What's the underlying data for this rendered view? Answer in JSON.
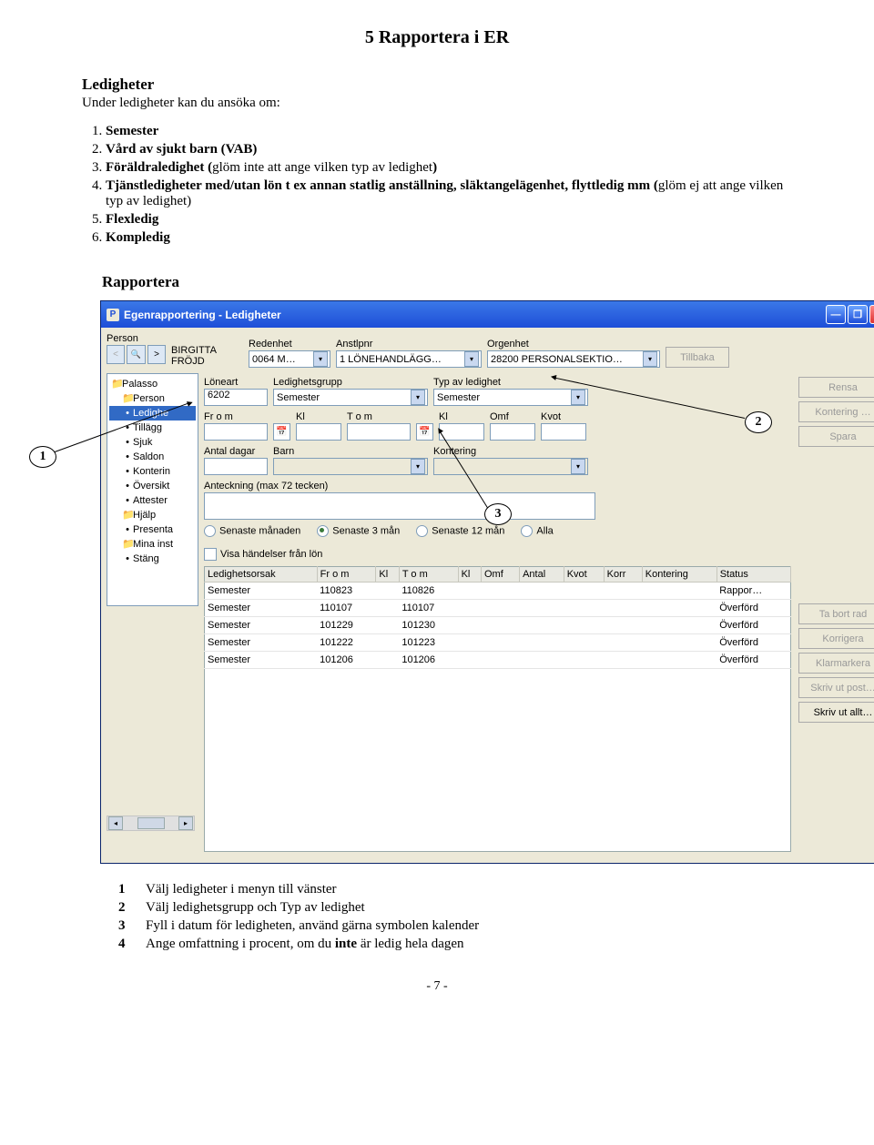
{
  "doc_title": "5 Rapportera i ER",
  "section": {
    "title": "Ledigheter",
    "sub": "Under ledigheter kan du ansöka om:"
  },
  "numlist": [
    {
      "bold": "Semester",
      "rest": ""
    },
    {
      "bold": "Vård av sjukt barn (VAB)",
      "rest": ""
    },
    {
      "bold": "Föräldraledighet (",
      "rest_plain": "glöm inte att ange vilken typ av ledighet",
      "bold_close": ")"
    },
    {
      "bold": "Tjänstledigheter med/utan lön t ex annan statlig anställning, släktangelägenhet, flyttledig mm (",
      "rest_plain": "glöm ej att ange vilken typ av ledighet)"
    },
    {
      "bold": "Flexledig",
      "rest": ""
    },
    {
      "bold": "Kompledig",
      "rest": ""
    }
  ],
  "rap_heading": "Rapportera",
  "window": {
    "title": "Egenrapportering - Ledigheter",
    "header": {
      "person_lbl": "Person",
      "person_val": "BIRGITTA FRÖJD",
      "redenhet_lbl": "Redenhet",
      "redenhet_val": "0064  M…",
      "anstlpnr_lbl": "Anstlpnr",
      "anstlpnr_val": "1   LÖNEHANDLÄGG…",
      "orgenhet_lbl": "Orgenhet",
      "orgenhet_val": "28200  PERSONALSEKTIO…",
      "tillbaka": "Tillbaka"
    },
    "tree": [
      {
        "icon": "📁",
        "text": "Palasso"
      },
      {
        "icon": "📁",
        "text": "Person",
        "indent": true
      },
      {
        "icon": "•",
        "text": "Ledighe",
        "indent": true,
        "sel": true
      },
      {
        "icon": "•",
        "text": "Tillägg",
        "indent": true
      },
      {
        "icon": "•",
        "text": "Sjuk",
        "indent": true
      },
      {
        "icon": "•",
        "text": "Saldon",
        "indent": true
      },
      {
        "icon": "•",
        "text": "Konterin",
        "indent": true
      },
      {
        "icon": "•",
        "text": "Översikt",
        "indent": true
      },
      {
        "icon": "•",
        "text": "Attester",
        "indent": true
      },
      {
        "icon": "📁",
        "text": "Hjälp",
        "indent": true
      },
      {
        "icon": "•",
        "text": "Presenta",
        "indent": true
      },
      {
        "icon": "📁",
        "text": "Mina inst",
        "indent": true
      },
      {
        "icon": "•",
        "text": "Stäng",
        "indent": true
      }
    ],
    "form": {
      "loneart_lbl": "Löneart",
      "loneart_val": "6202",
      "ledgrupp_lbl": "Ledighetsgrupp",
      "ledgrupp_val": "Semester",
      "typ_lbl": "Typ av ledighet",
      "typ_val": "Semester",
      "from_lbl": "Fr o m",
      "kl_lbl": "Kl",
      "tom_lbl": "T o m",
      "kl2_lbl": "Kl",
      "omf_lbl": "Omf",
      "kvot_lbl": "Kvot",
      "antaldagar_lbl": "Antal dagar",
      "barn_lbl": "Barn",
      "kontering_lbl": "Kontering",
      "anteck_lbl": "Anteckning (max 72 tecken)",
      "radio1": "Senaste månaden",
      "radio2": "Senaste 3 mån",
      "radio3": "Senaste 12 mån",
      "radio4": "Alla",
      "visa_chk": "Visa händelser från lön"
    },
    "right_buttons": {
      "rensa": "Rensa",
      "kontering": "Kontering …",
      "spara": "Spara"
    },
    "right_buttons2": {
      "tabort": "Ta bort rad",
      "korrigera": "Korrigera",
      "klarmarkera": "Klarmarkera",
      "skrivpost": "Skriv ut post…",
      "skrivallt": "Skriv ut allt…"
    },
    "grid": {
      "cols": [
        "Ledighetsorsak",
        "Fr o m",
        "Kl",
        "T o m",
        "Kl",
        "Omf",
        "Antal",
        "Kvot",
        "Korr",
        "Kontering",
        "Status"
      ],
      "rows": [
        {
          "orsak": "Semester",
          "from": "110823",
          "tom": "110826",
          "status": "Rappor…"
        },
        {
          "orsak": "Semester",
          "from": "110107",
          "tom": "110107",
          "status": "Överförd"
        },
        {
          "orsak": "Semester",
          "from": "101229",
          "tom": "101230",
          "status": "Överförd"
        },
        {
          "orsak": "Semester",
          "from": "101222",
          "tom": "101223",
          "status": "Överförd"
        },
        {
          "orsak": "Semester",
          "from": "101206",
          "tom": "101206",
          "status": "Överförd"
        }
      ]
    }
  },
  "callouts": {
    "c1": "1",
    "c2": "2",
    "c3": "3"
  },
  "bottom": [
    {
      "n": "1",
      "t": "Välj ledigheter i menyn till vänster"
    },
    {
      "n": "2",
      "t": "Välj ledighetsgrupp och Typ av ledighet"
    },
    {
      "n": "3",
      "t": "Fyll i datum för ledigheten, använd gärna symbolen kalender"
    },
    {
      "n": "4",
      "t_pre": "Ange omfattning i procent, om du ",
      "t_bold": "inte",
      "t_post": " är ledig hela dagen"
    }
  ],
  "page_num": "- 7 -"
}
